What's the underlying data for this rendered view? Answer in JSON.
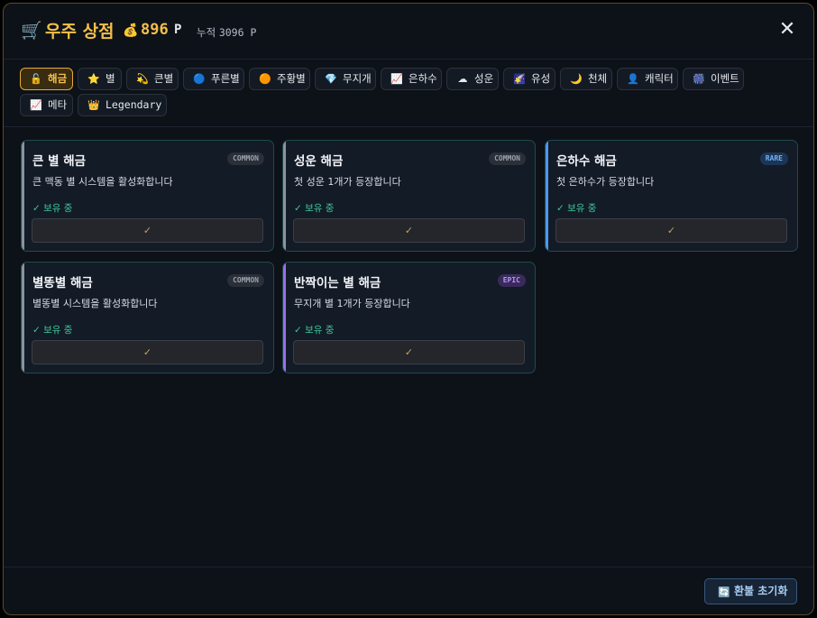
{
  "header": {
    "title": "우주 상점",
    "points": "896",
    "points_unit": "P",
    "total_label": "누적",
    "total_value": "3096 P"
  },
  "tabs": [
    {
      "label": "해금",
      "icon": "lock-icon",
      "glyph": "🔓",
      "active": true
    },
    {
      "label": "별",
      "icon": "star-icon",
      "glyph": "⭐"
    },
    {
      "label": "큰별",
      "icon": "dizzy-star-icon",
      "glyph": "💫"
    },
    {
      "label": "푸른별",
      "icon": "blue-circle-icon",
      "glyph": "🔵"
    },
    {
      "label": "주황별",
      "icon": "orange-circle-icon",
      "glyph": "🟠"
    },
    {
      "label": "무지개",
      "icon": "gem-icon",
      "glyph": "💎"
    },
    {
      "label": "은하수",
      "icon": "chart-icon",
      "glyph": "📈"
    },
    {
      "label": "성운",
      "icon": "cloud-icon",
      "glyph": "☁"
    },
    {
      "label": "유성",
      "icon": "meteor-icon",
      "glyph": "🌠"
    },
    {
      "label": "천체",
      "icon": "moon-icon",
      "glyph": "🌙"
    },
    {
      "label": "캐릭터",
      "icon": "person-icon",
      "glyph": "👤"
    },
    {
      "label": "이벤트",
      "icon": "fireworks-icon",
      "glyph": "🎆"
    },
    {
      "label": "메타",
      "icon": "trend-icon",
      "glyph": "📈"
    },
    {
      "label": "Legendary",
      "icon": "crown-icon",
      "glyph": "👑"
    }
  ],
  "cards": [
    {
      "name": "큰 별 해금",
      "rarity": "COMMON",
      "desc": "큰 맥동 별 시스템을 활성화합니다",
      "status": "✓ 보유 중",
      "button": "✓",
      "accent": "#8a939f"
    },
    {
      "name": "성운 해금",
      "rarity": "COMMON",
      "desc": "첫 성운 1개가 등장합니다",
      "status": "✓ 보유 중",
      "button": "✓",
      "accent": "#8a939f"
    },
    {
      "name": "은하수 해금",
      "rarity": "RARE",
      "desc": "첫 은하수가 등장합니다",
      "status": "✓ 보유 중",
      "button": "✓",
      "accent": "#4b98f0"
    },
    {
      "name": "별똥별 해금",
      "rarity": "COMMON",
      "desc": "별똥별 시스템을 활성화합니다",
      "status": "✓ 보유 중",
      "button": "✓",
      "accent": "#8a939f"
    },
    {
      "name": "반짝이는 별 해금",
      "rarity": "EPIC",
      "desc": "무지개 별 1개가 등장합니다",
      "status": "✓ 보유 중",
      "button": "✓",
      "accent": "#9a6df0"
    }
  ],
  "footer": {
    "reset_label": "환불 초기화"
  }
}
